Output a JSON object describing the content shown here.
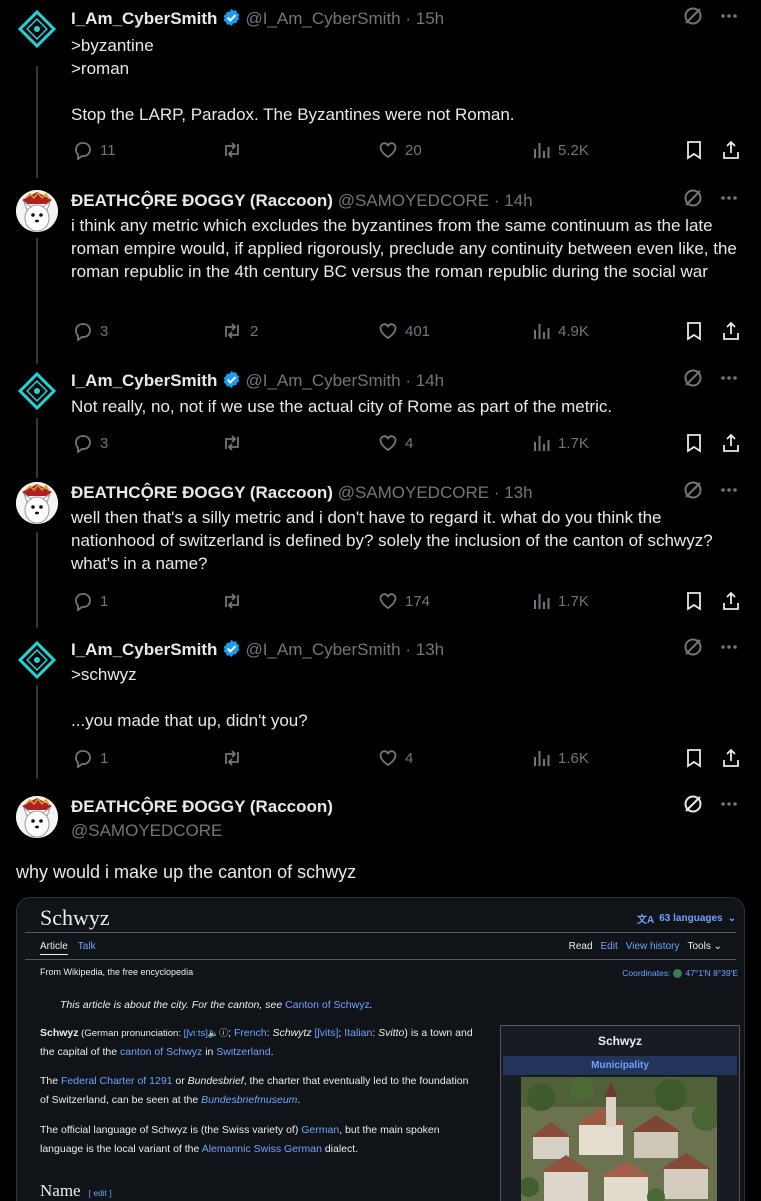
{
  "colors": {
    "background": "#000000",
    "text": "#e7e9ea",
    "muted": "#71767b",
    "verified": "#1d9bf0",
    "wiki_link": "#6ea2ff"
  },
  "tweets": [
    {
      "name": "I_Am_CyberSmith",
      "verified": true,
      "handle": "@I_Am_CyberSmith",
      "time": "· 15h",
      "text": ">byzantine\n>roman\n\nStop the LARP, Paradox. The Byzantines were not Roman.",
      "replies": "11",
      "reposts": "",
      "likes": "20",
      "views": "5.2K"
    },
    {
      "name": "ĐEATHCỘRE ĐOGGY (Raccoon)",
      "verified": false,
      "handle": "@SAMOYEDCORE",
      "time": "· 14h",
      "text": "i think any metric which excludes the byzantines from the same continuum as the late roman empire would, if applied rigorously, preclude any continuity between even like, the roman republic in the 4th century BC versus the roman republic during the social war",
      "replies": "3",
      "reposts": "2",
      "likes": "401",
      "views": "4.9K"
    },
    {
      "name": "I_Am_CyberSmith",
      "verified": true,
      "handle": "@I_Am_CyberSmith",
      "time": "· 14h",
      "text": "Not really, no, not if we use the actual city of Rome as part of the metric.",
      "replies": "3",
      "reposts": "",
      "likes": "4",
      "views": "1.7K"
    },
    {
      "name": "ĐEATHCỘRE ĐOGGY (Raccoon)",
      "verified": false,
      "handle": "@SAMOYEDCORE",
      "time": "· 13h",
      "text": "well then that's a silly metric and i don't have to regard it. what do you think the nationhood of switzerland is defined by? solely the inclusion of the canton of schwyz? what's in a name?",
      "replies": "1",
      "reposts": "",
      "likes": "174",
      "views": "1.7K"
    },
    {
      "name": "I_Am_CyberSmith",
      "verified": true,
      "handle": "@I_Am_CyberSmith",
      "time": "· 13h",
      "text": ">schwyz\n\n...you made that up, didn't you?",
      "replies": "1",
      "reposts": "",
      "likes": "4",
      "views": "1.6K"
    }
  ],
  "main_tweet": {
    "name": "ĐEATHCỘRE ĐOGGY (Raccoon)",
    "handle": "@SAMOYEDCORE",
    "text": "why would i make up the canton of schwyz"
  },
  "wiki": {
    "title": "Schwyz",
    "languages": "63 languages",
    "tab_article": "Article",
    "tab_talk": "Talk",
    "tab_read": "Read",
    "tab_edit": "Edit",
    "tab_history": "View history",
    "tab_tools": "Tools",
    "from": "From Wikipedia, the free encyclopedia",
    "coords_label": "Coordinates:",
    "coords_value": "47°1′N 8°39′E",
    "hatnote_text": "This article is about the city. For the canton, see ",
    "hatnote_link": "Canton of Schwyz",
    "hatnote_end": ".",
    "p1": {
      "bold": "Schwyz",
      "a": " (German pronunciation: ",
      "ipa1": "[ʃviːts]",
      "b": "; ",
      "french": "French",
      "c": ": ",
      "fr_italic": "Schwytz",
      "d": " ",
      "ipa2": "[ʃvits]",
      "e": "; ",
      "italian": "Italian",
      "f": ": ",
      "it_italic": "Svitto",
      "g": ") is a town and the capital of the ",
      "link1": "canton of Schwyz",
      "h": " in ",
      "link2": "Switzerland",
      "i": "."
    },
    "p2": {
      "a": "The ",
      "link1": "Federal Charter of 1291",
      "b": " or ",
      "italic": "Bundesbrief",
      "c": ", the charter that eventually led to the foundation of Switzerland, can be seen at the ",
      "link2": "Bundesbriefmuseum",
      "d": "."
    },
    "p3": {
      "a": "The official language of Schwyz is (the Swiss variety of) ",
      "link1": "German",
      "b": ", but the main spoken language is the local variant of the ",
      "link2": "Alemannic Swiss German",
      "c": " dialect."
    },
    "section_name": "Name",
    "section_edit": "[ edit ]",
    "infobox_title": "Schwyz",
    "infobox_sub": "Municipality"
  }
}
